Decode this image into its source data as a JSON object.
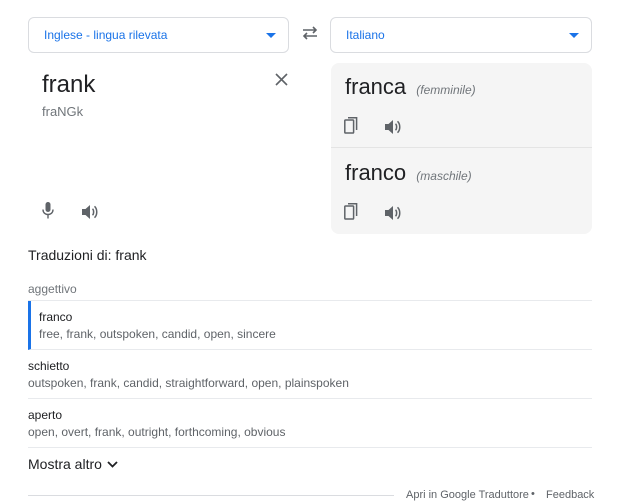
{
  "source_select": {
    "label": "Inglese - lingua rilevata",
    "icon": "caret-down-icon"
  },
  "target_select": {
    "label": "Italiano",
    "icon": "caret-down-icon"
  },
  "swap": {
    "icon": "swap-arrows-icon"
  },
  "source": {
    "word": "frank",
    "transliteration": "fraNGk",
    "icons": [
      "close-icon",
      "microphone-icon",
      "speaker-icon"
    ]
  },
  "target": {
    "results": [
      {
        "word": "franca",
        "gender": "(femminile)"
      },
      {
        "word": "franco",
        "gender": "(maschile)"
      }
    ],
    "icons": [
      "copy-icon",
      "speaker-icon"
    ]
  },
  "dictionary": {
    "heading": "Traduzioni di: frank",
    "part_of_speech": "aggettivo",
    "entries": [
      {
        "word": "franco",
        "synonyms": "free, frank, outspoken, candid, open, sincere"
      },
      {
        "word": "schietto",
        "synonyms": "outspoken, frank, candid, straightforward, open, plainspoken"
      },
      {
        "word": "aperto",
        "synonyms": "open, overt, frank, outright, forthcoming, obvious"
      }
    ],
    "more_label": "Mostra altro"
  },
  "footer": {
    "open_link": "Apri in Google Traduttore",
    "separator": "•",
    "feedback": "Feedback"
  },
  "colors": {
    "accent": "#1a73e8",
    "panel_bg": "#f5f5f5",
    "icon": "#5f6368"
  }
}
